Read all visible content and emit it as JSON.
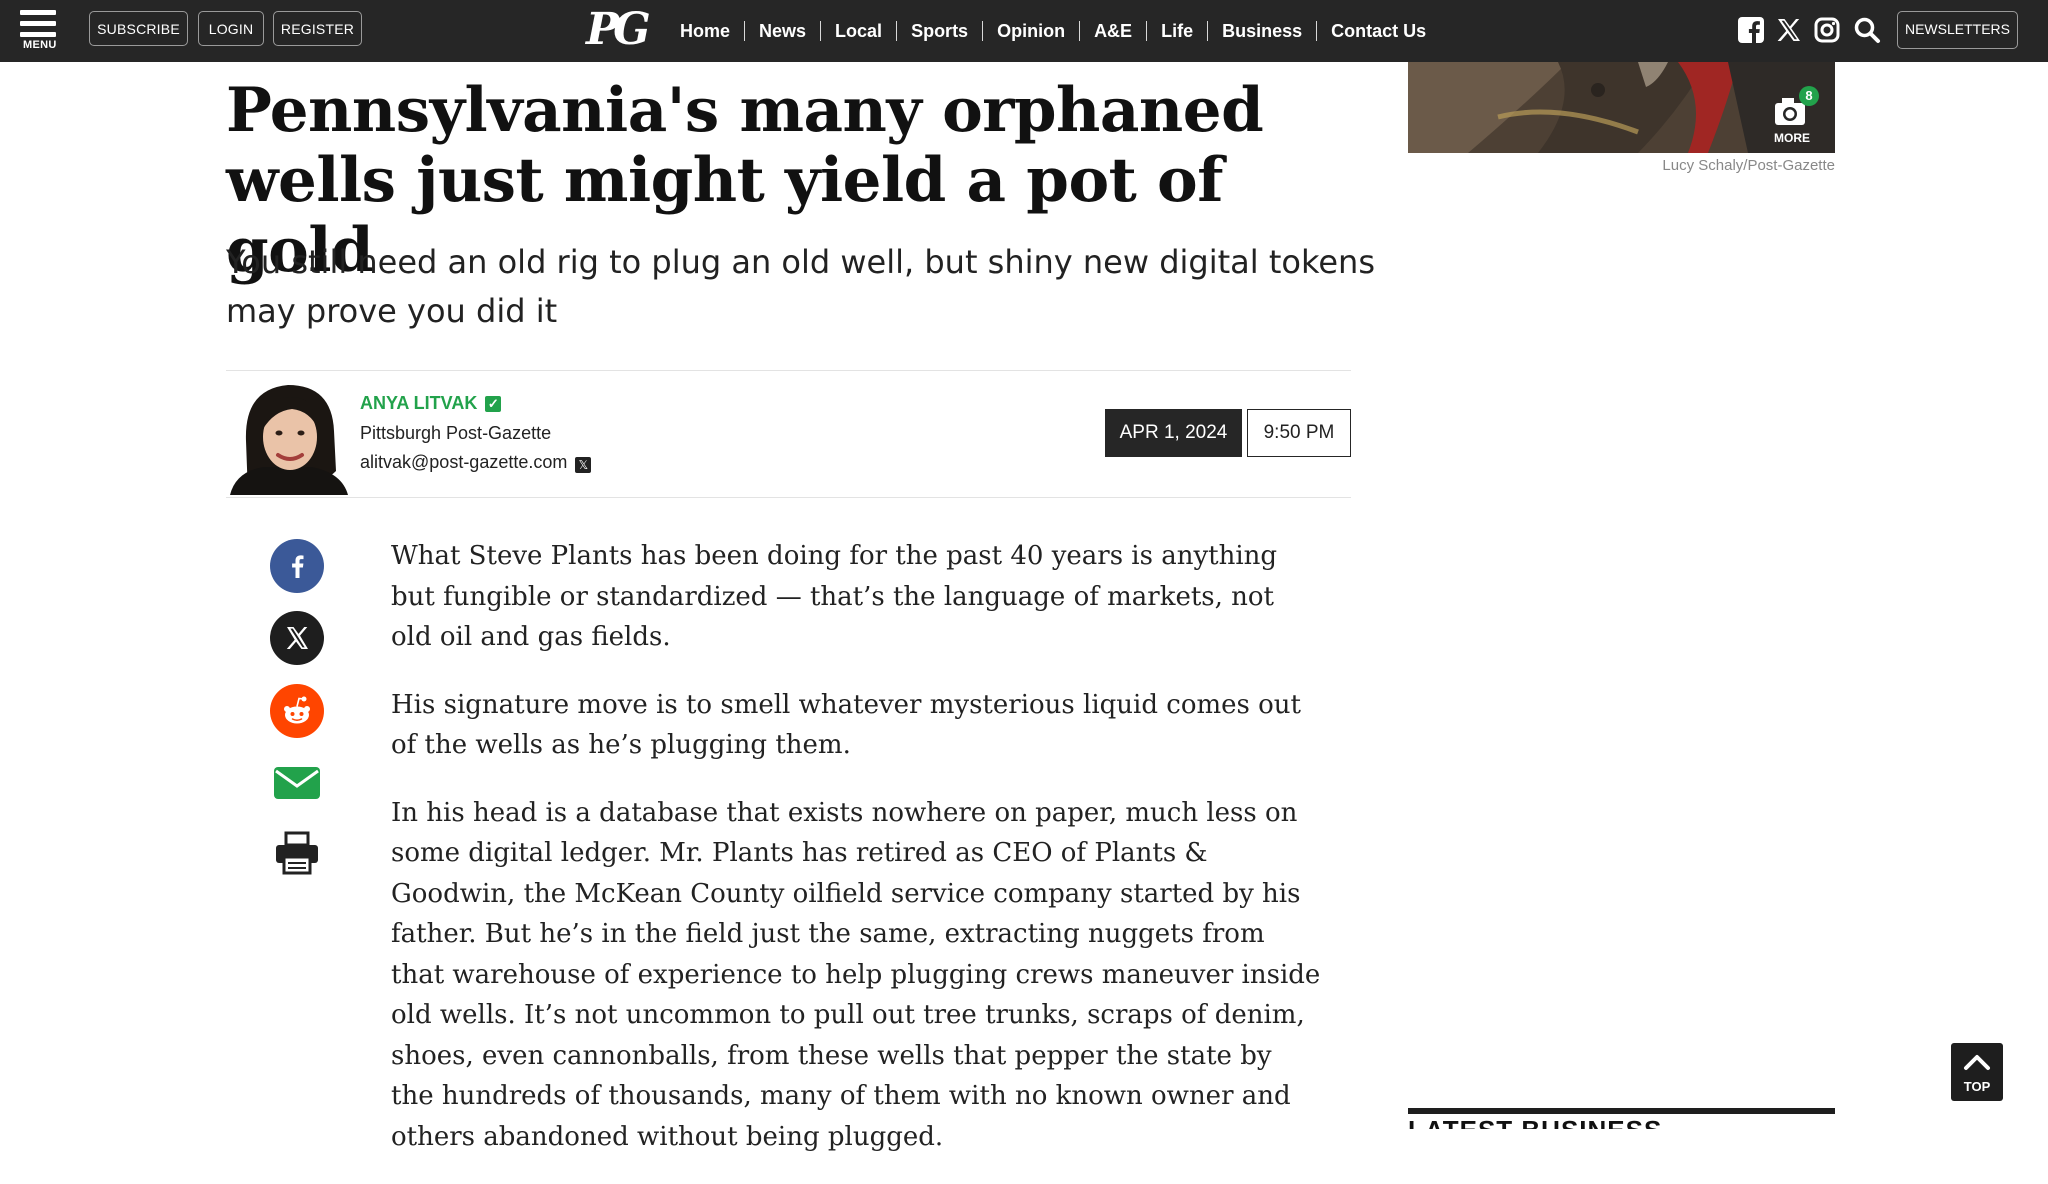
{
  "header": {
    "menu_label": "MENU",
    "subscribe_label": "SUBSCRIBE",
    "login_label": "LOGIN",
    "register_label": "REGISTER",
    "logo_text": "PG",
    "nav_items": [
      "Home",
      "News",
      "Local",
      "Sports",
      "Opinion",
      "A&E",
      "Life",
      "Business",
      "Contact Us"
    ],
    "newsletters_label": "NEWSLETTERS",
    "icons": [
      "facebook-icon",
      "x-icon",
      "instagram-icon",
      "search-icon"
    ]
  },
  "article": {
    "headline": "Pennsylvania's many orphaned wells just might yield a pot of gold",
    "subheadline": "You still need an old rig to plug an old well, but shiny new digital tokens may prove you did it",
    "author": {
      "name": "ANYA LITVAK",
      "organization": "Pittsburgh Post-Gazette",
      "email": "alitvak@post-gazette.com"
    },
    "date": "APR 1, 2024",
    "time": "9:50 PM",
    "paragraphs": [
      "What Steve Plants has been doing for the past 40 years is anything but fungible or standardized — that’s the language of markets, not old oil and gas fields.",
      "His signature move is to smell whatever mysterious liquid comes out of the wells as he’s plugging them.",
      "In his head is a database that exists nowhere on paper, much less on some digital ledger. Mr. Plants has retired as CEO of Plants & Goodwin, the McKean County oilfield service company started by his father. But he’s in the field just the same, extracting nuggets from that warehouse of experience to help plugging crews maneuver inside old wells. It’s not uncommon to pull out tree trunks, scraps of denim, shoes, even cannonballs, from these wells that pepper the state by the hundreds of thousands, many of them with no known owner and others abandoned without being plugged."
    ]
  },
  "share_icons": [
    "facebook-icon",
    "x-icon",
    "reddit-icon",
    "email-icon",
    "print-icon"
  ],
  "sidebar": {
    "photo_count": "8",
    "more_label": "MORE",
    "photo_credit": "Lucy Schaly/Post-Gazette",
    "latest_heading": "LATEST BUSINESS"
  },
  "back_to_top_label": "TOP",
  "colors": {
    "nav_bg": "#262626",
    "accent_green": "#22a24b",
    "facebook_blue": "#3b5998",
    "reddit_orange": "#ff4500"
  }
}
